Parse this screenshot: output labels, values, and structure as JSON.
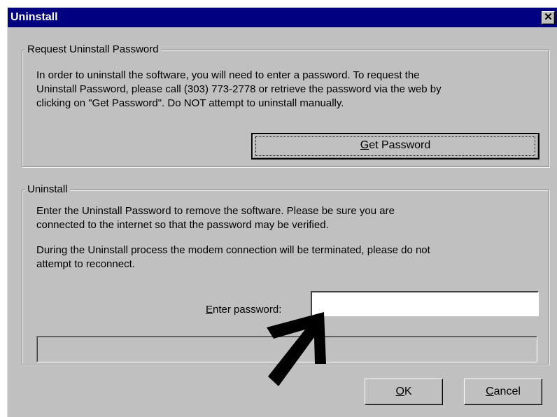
{
  "window": {
    "title": "Uninstall",
    "close_glyph": "✕"
  },
  "request_group": {
    "legend": "Request Uninstall Password",
    "text_lines": [
      "In order to uninstall the software, you will need to enter a password.  To request the",
      "Uninstall Password, please call (303) 773-2778 or retrieve the password via the web by",
      "clicking on \"Get Password\".  Do NOT attempt to uninstall manually."
    ],
    "get_password_button": {
      "mnemonic": "G",
      "rest": "et  Password"
    }
  },
  "uninstall_group": {
    "legend": "Uninstall",
    "para1_lines": [
      "Enter the Uninstall Password  to remove the software.  Please be sure you are",
      "connected to the internet so that the password may be verified."
    ],
    "para2_lines": [
      "During the Uninstall process the modem connection will be terminated, please do not",
      "attempt to reconnect."
    ],
    "password_label": {
      "mnemonic": "E",
      "rest": "nter password:"
    },
    "password_field": {
      "value": "",
      "placeholder": ""
    },
    "status_bar_text": ""
  },
  "buttons": {
    "ok": {
      "mnemonic": "O",
      "rest": "K"
    },
    "cancel": {
      "mnemonic": "C",
      "rest": "ancel"
    }
  },
  "annotation": {
    "arrow_icon": "arrow-pointing-to-password-field",
    "color": "#000000"
  },
  "colors": {
    "titlebar": "#000080",
    "face": "#c0c0c0"
  }
}
